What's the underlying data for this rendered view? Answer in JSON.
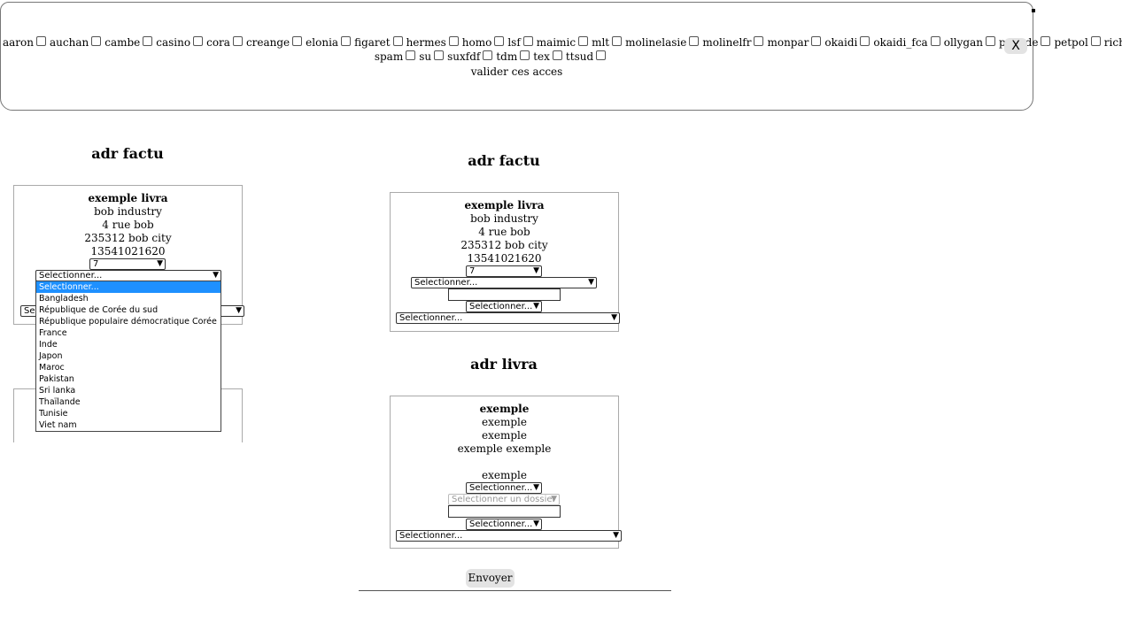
{
  "accesses": {
    "row1": [
      "aaron",
      "auchan",
      "cambe",
      "casino",
      "cora",
      "creange",
      "elonia",
      "figaret",
      "hermes",
      "homo",
      "lsf",
      "maimic",
      "mlt",
      "molinelasie",
      "molinelfr",
      "monpar",
      "okaidi",
      "okaidi_fca",
      "ollygan",
      "papade",
      "petpol",
      "richf"
    ],
    "row2": [
      "spam",
      "su",
      "suxfdf",
      "tdm",
      "tex",
      "ttsud"
    ],
    "validate_label": "valider ces acces",
    "close_label": "X"
  },
  "left_panel": {
    "title": "adr factu",
    "name": "exemple livra",
    "company": "bob industry",
    "street": "4 rue bob",
    "city": "235312 bob city",
    "phone": "13541021620",
    "select_small_value": "7",
    "country_select_value": "Selectionner...",
    "partial_select_value": "Se"
  },
  "dropdown": {
    "options": [
      "Selectionner...",
      "Bangladesh",
      "République de Corée du sud",
      "République populaire démocratique Corée",
      "France",
      "Inde",
      "Japon",
      "Maroc",
      "Pakistan",
      "Sri lanka",
      "Thaïlande",
      "Tunisie",
      "Viet nam"
    ],
    "selected_index": 0
  },
  "right_factu": {
    "title": "adr factu",
    "name": "exemple livra",
    "company": "bob industry",
    "street": "4 rue bob",
    "city": "235312 bob city",
    "phone": "13541021620",
    "select_small_value": "7",
    "country_select_value": "Selectionner...",
    "text_input_value": "",
    "select_mid_value": "Selectionner...",
    "select_wide_value": "Selectionner..."
  },
  "right_livra": {
    "title": "adr livra",
    "name": "exemple",
    "company": "exemple",
    "street": "exemple",
    "city": "exemple exemple",
    "phone": "exemple",
    "select_mid_value": "Selectionner...",
    "folder_select_value": "Selectionner un dossier",
    "text_input_value": "",
    "select_mid2_value": "Selectionner...",
    "select_wide_value": "Selectionner..."
  },
  "submit_label": "Envoyer"
}
